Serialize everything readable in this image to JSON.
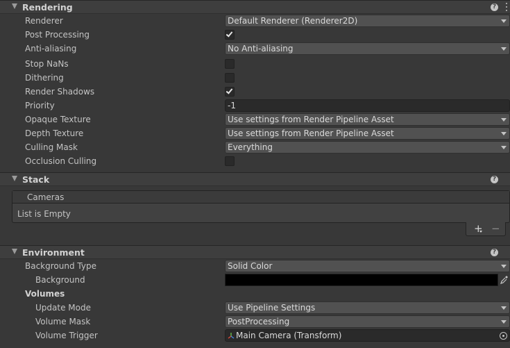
{
  "rendering": {
    "title": "Rendering",
    "rows": {
      "renderer": {
        "label": "Renderer",
        "value": "Default Renderer (Renderer2D)"
      },
      "post_processing": {
        "label": "Post Processing",
        "checked": true
      },
      "anti_aliasing": {
        "label": "Anti-aliasing",
        "value": "No Anti-aliasing"
      },
      "stop_nans": {
        "label": "Stop NaNs",
        "checked": false
      },
      "dithering": {
        "label": "Dithering",
        "checked": false
      },
      "render_shadows": {
        "label": "Render Shadows",
        "checked": true
      },
      "priority": {
        "label": "Priority",
        "value": "-1"
      },
      "opaque_texture": {
        "label": "Opaque Texture",
        "value": "Use settings from Render Pipeline Asset"
      },
      "depth_texture": {
        "label": "Depth Texture",
        "value": "Use settings from Render Pipeline Asset"
      },
      "culling_mask": {
        "label": "Culling Mask",
        "value": "Everything"
      },
      "occlusion_culling": {
        "label": "Occlusion Culling",
        "checked": false
      }
    }
  },
  "stack": {
    "title": "Stack",
    "list_header": "Cameras",
    "empty_text": "List is Empty",
    "add_symbol": "+",
    "remove_symbol": "−"
  },
  "environment": {
    "title": "Environment",
    "rows": {
      "background_type": {
        "label": "Background Type",
        "value": "Solid Color"
      },
      "background": {
        "label": "Background",
        "color": "#000000"
      },
      "volumes": {
        "label": "Volumes"
      },
      "update_mode": {
        "label": "Update Mode",
        "value": "Use Pipeline Settings"
      },
      "volume_mask": {
        "label": "Volume Mask",
        "value": "PostProcessing"
      },
      "volume_trigger": {
        "label": "Volume Trigger",
        "value": "Main Camera (Transform)"
      }
    }
  },
  "icons": {
    "help": "help-icon",
    "kebab": "kebab-menu-icon",
    "foldout": "foldout-arrow-icon",
    "dropdown": "chevron-down-icon",
    "eyedropper": "eyedropper-icon",
    "transform": "transform-icon",
    "object_picker": "object-picker-icon"
  }
}
